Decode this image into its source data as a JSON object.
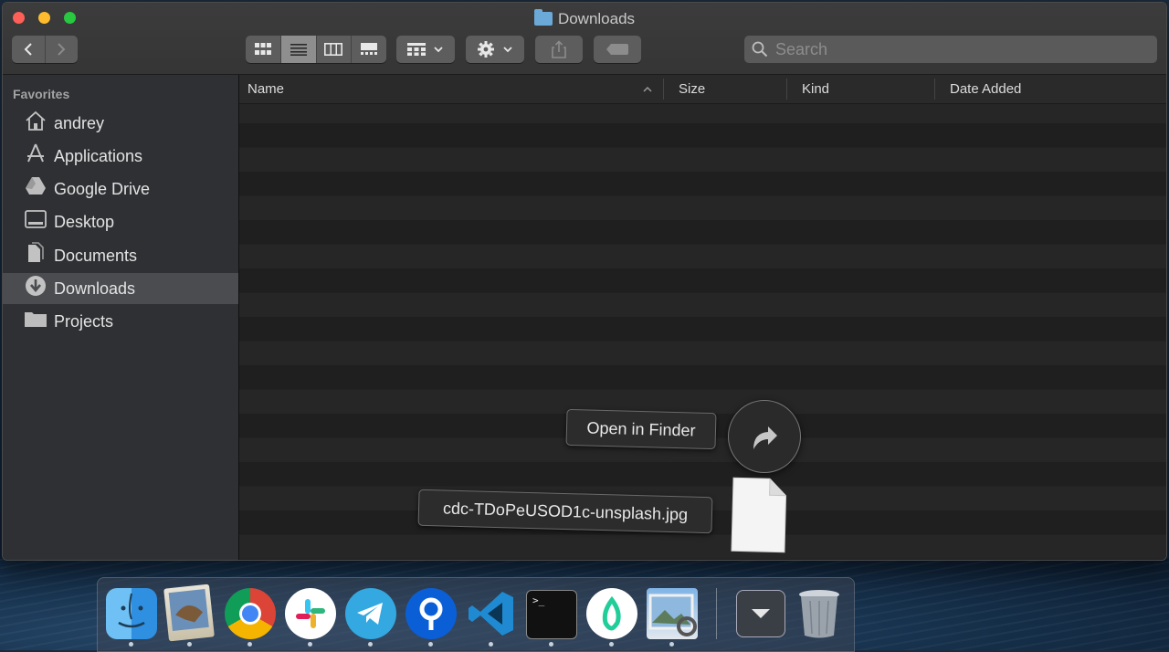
{
  "window": {
    "title": "Downloads"
  },
  "search": {
    "placeholder": "Search"
  },
  "sidebar": {
    "section_title": "Favorites",
    "items": [
      {
        "label": "andrey",
        "icon": "home-icon"
      },
      {
        "label": "Applications",
        "icon": "applications-icon"
      },
      {
        "label": "Google Drive",
        "icon": "google-drive-icon"
      },
      {
        "label": "Desktop",
        "icon": "desktop-icon"
      },
      {
        "label": "Documents",
        "icon": "documents-icon"
      },
      {
        "label": "Downloads",
        "icon": "downloads-icon",
        "selected": true
      },
      {
        "label": "Projects",
        "icon": "folder-icon"
      }
    ]
  },
  "columns": {
    "name": "Name",
    "size": "Size",
    "kind": "Kind",
    "date_added": "Date Added"
  },
  "overlay": {
    "open_in_finder": "Open in Finder",
    "file_name": "cdc-TDoPeUSOD1c-unsplash.jpg"
  },
  "dock": {
    "apps": [
      "finder-icon",
      "preview-icon",
      "chrome-icon",
      "slack-icon",
      "telegram-icon",
      "sourcetree-icon",
      "vscode-icon",
      "terminal-icon",
      "robinhood-icon",
      "photo-viewer-icon"
    ],
    "terminal_prompt": ">_"
  },
  "colors": {
    "selected_row": "#4a4c50",
    "search_bg": "#5a5a5a"
  }
}
